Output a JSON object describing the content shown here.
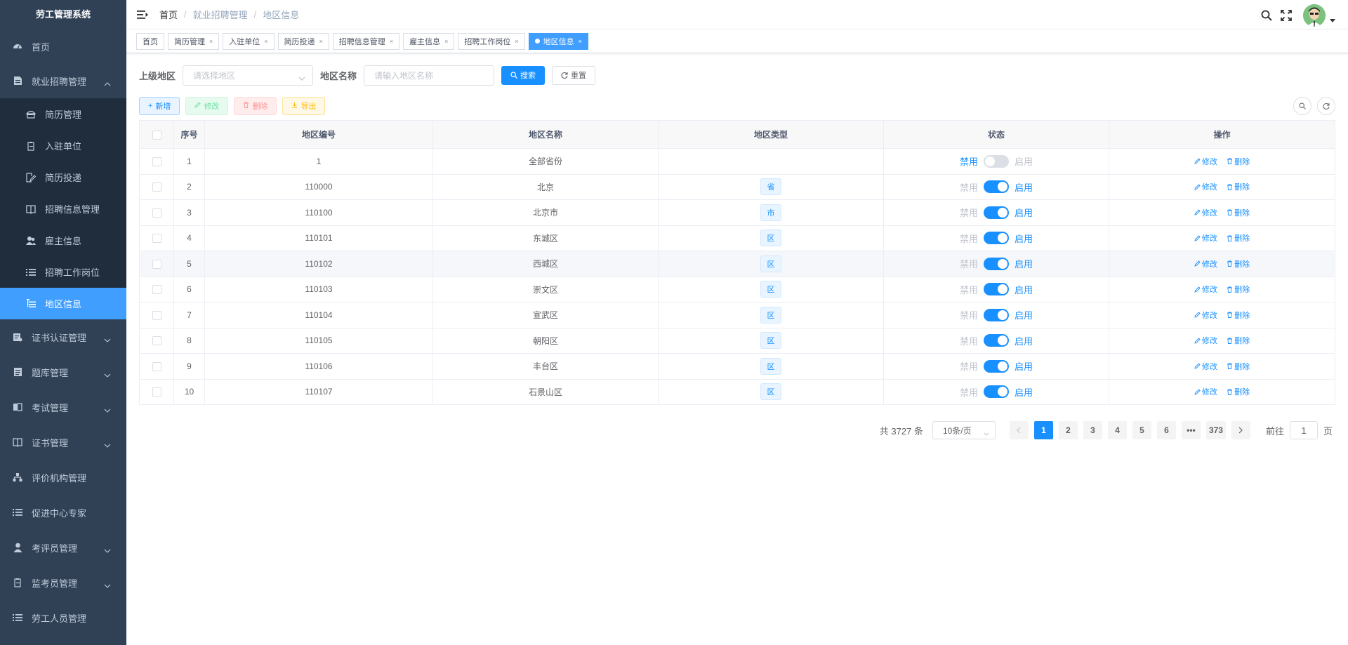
{
  "app": {
    "title": "劳工管理系统"
  },
  "sidebar": {
    "items": [
      {
        "label": "首页",
        "icon": "dashboard-icon"
      },
      {
        "label": "就业招聘管理",
        "icon": "document-icon",
        "expanded": true
      },
      {
        "label": "证书认证管理",
        "icon": "certificate-icon"
      },
      {
        "label": "题库管理",
        "icon": "list-doc-icon"
      },
      {
        "label": "考试管理",
        "icon": "exam-icon"
      },
      {
        "label": "证书管理",
        "icon": "book-icon"
      },
      {
        "label": "评价机构管理",
        "icon": "tree-icon"
      },
      {
        "label": "促进中心专家",
        "icon": "list-icon"
      },
      {
        "label": "考评员管理",
        "icon": "user-icon"
      },
      {
        "label": "监考员管理",
        "icon": "clipboard-icon"
      },
      {
        "label": "劳工人员管理",
        "icon": "list-icon"
      }
    ],
    "submenu": [
      {
        "label": "简历管理",
        "icon": "hat-icon"
      },
      {
        "label": "入驻单位",
        "icon": "clipboard-icon"
      },
      {
        "label": "简历投递",
        "icon": "edit-icon"
      },
      {
        "label": "招聘信息管理",
        "icon": "book-icon"
      },
      {
        "label": "雇主信息",
        "icon": "peoples-icon"
      },
      {
        "label": "招聘工作岗位",
        "icon": "list-icon"
      },
      {
        "label": "地区信息",
        "icon": "tree-table-icon",
        "active": true
      }
    ]
  },
  "breadcrumb": [
    "首页",
    "就业招聘管理",
    "地区信息"
  ],
  "tags": [
    {
      "label": "首页",
      "closable": false
    },
    {
      "label": "简历管理",
      "closable": true
    },
    {
      "label": "入驻单位",
      "closable": true
    },
    {
      "label": "简历投递",
      "closable": true
    },
    {
      "label": "招聘信息管理",
      "closable": true
    },
    {
      "label": "雇主信息",
      "closable": true
    },
    {
      "label": "招聘工作岗位",
      "closable": true
    },
    {
      "label": "地区信息",
      "closable": true,
      "active": true
    }
  ],
  "search": {
    "parent_label": "上级地区",
    "parent_placeholder": "请选择地区",
    "name_label": "地区名称",
    "name_placeholder": "请输入地区名称",
    "search_btn": "搜索",
    "reset_btn": "重置"
  },
  "toolbar": {
    "add": "新增",
    "edit": "修改",
    "delete": "删除",
    "export": "导出"
  },
  "table": {
    "headers": [
      "序号",
      "地区编号",
      "地区名称",
      "地区类型",
      "状态",
      "操作"
    ],
    "rows": [
      {
        "idx": "1",
        "code": "1",
        "name": "全部省份",
        "type": "",
        "enabled": false
      },
      {
        "idx": "2",
        "code": "110000",
        "name": "北京",
        "type": "省",
        "enabled": true
      },
      {
        "idx": "3",
        "code": "110100",
        "name": "北京市",
        "type": "市",
        "enabled": true
      },
      {
        "idx": "4",
        "code": "110101",
        "name": "东城区",
        "type": "区",
        "enabled": true
      },
      {
        "idx": "5",
        "code": "110102",
        "name": "西城区",
        "type": "区",
        "enabled": true
      },
      {
        "idx": "6",
        "code": "110103",
        "name": "崇文区",
        "type": "区",
        "enabled": true
      },
      {
        "idx": "7",
        "code": "110104",
        "name": "宣武区",
        "type": "区",
        "enabled": true
      },
      {
        "idx": "8",
        "code": "110105",
        "name": "朝阳区",
        "type": "区",
        "enabled": true
      },
      {
        "idx": "9",
        "code": "110106",
        "name": "丰台区",
        "type": "区",
        "enabled": true
      },
      {
        "idx": "10",
        "code": "110107",
        "name": "石景山区",
        "type": "区",
        "enabled": true
      }
    ],
    "switch_off_label": "禁用",
    "switch_on_label": "启用",
    "op_edit": "修改",
    "op_delete": "删除"
  },
  "pagination": {
    "total_text": "共 3727 条",
    "page_size": "10条/页",
    "pages": [
      "1",
      "2",
      "3",
      "4",
      "5",
      "6",
      "•••",
      "373"
    ],
    "current": "1",
    "goto_prefix": "前往",
    "goto_value": "1",
    "goto_suffix": "页"
  },
  "colors": {
    "primary": "#1890ff",
    "sidebar_bg": "#304156",
    "submenu_bg": "#1f2d3d"
  }
}
